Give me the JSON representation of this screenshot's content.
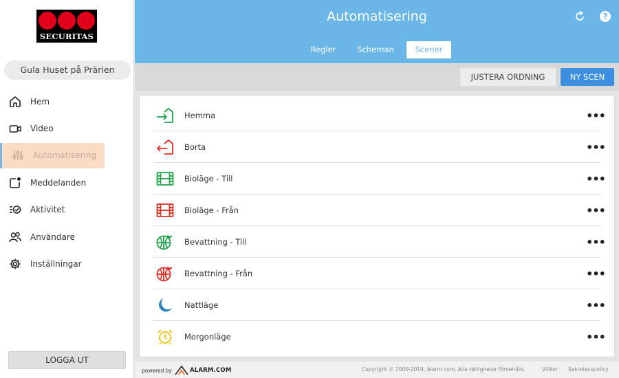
{
  "brand": {
    "logo_text": "SECURITAS",
    "logo_dot_color": "#e1001a"
  },
  "location": {
    "name": "Gula Huset på Prärien"
  },
  "sidebar": {
    "items": [
      {
        "label": "Hem",
        "icon": "home-icon"
      },
      {
        "label": "Video",
        "icon": "video-icon"
      },
      {
        "label": "Automatisering",
        "icon": "sliders-icon",
        "active": true
      },
      {
        "label": "Meddelanden",
        "icon": "notification-icon"
      },
      {
        "label": "Aktivitet",
        "icon": "activity-icon"
      },
      {
        "label": "Användare",
        "icon": "users-icon"
      },
      {
        "label": "Inställningar",
        "icon": "gear-icon"
      }
    ],
    "logout_label": "LOGGA UT"
  },
  "header": {
    "title": "Automatisering",
    "refresh_icon": "refresh-icon",
    "help_icon": "help-icon",
    "tabs": [
      {
        "label": "Regler"
      },
      {
        "label": "Scheman"
      },
      {
        "label": "Scener",
        "active": true
      }
    ]
  },
  "actions": {
    "reorder_label": "JUSTERA ORDNING",
    "new_scene_label": "NY SCEN"
  },
  "scenes": [
    {
      "label": "Hemma",
      "icon": "arrive-home-icon",
      "color": "#1ea34a"
    },
    {
      "label": "Borta",
      "icon": "leave-home-icon",
      "color": "#e02b20"
    },
    {
      "label": "Bioläge - Till",
      "icon": "film-icon",
      "color": "#1ea34a"
    },
    {
      "label": "Bioläge - Från",
      "icon": "film-icon",
      "color": "#e02b20"
    },
    {
      "label": "Bevattning - Till",
      "icon": "globe-icon",
      "color": "#1ea34a"
    },
    {
      "label": "Bevattning - Från",
      "icon": "globe-icon",
      "color": "#e02b20"
    },
    {
      "label": "Nattläge",
      "icon": "moon-icon",
      "color": "#2a7fc0"
    },
    {
      "label": "Morgonläge",
      "icon": "alarm-clock-icon",
      "color": "#f2c200"
    }
  ],
  "more_icon": "more-icon",
  "footer": {
    "powered_by": "powered by",
    "alarm_brand": "ALARM.COM",
    "copyright": "Copyright © 2000-2019, Alarm.com. Alla rättigheter förbehålls.",
    "terms": "Villkor",
    "privacy": "Sekretesspolicy"
  }
}
